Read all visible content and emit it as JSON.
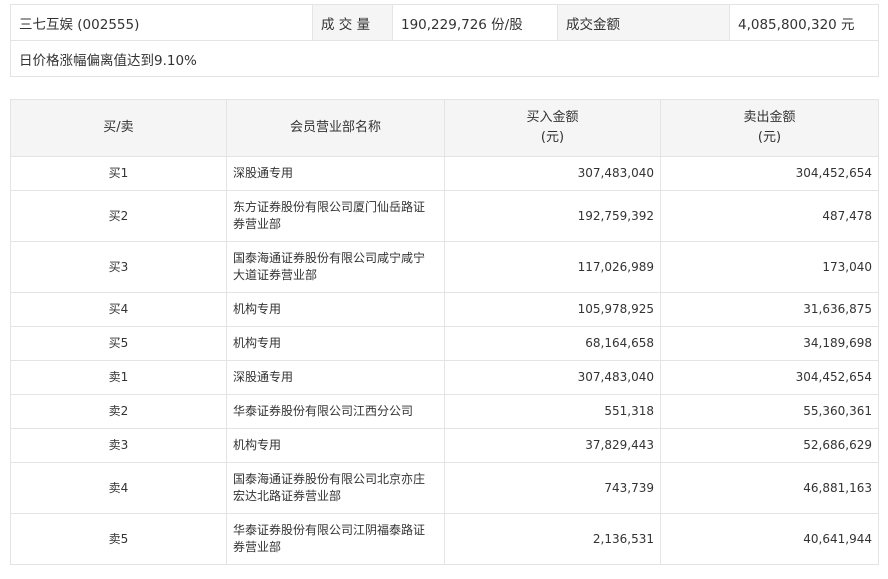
{
  "summary": {
    "stock": "三七互娱 (002555)",
    "volume_label": "成 交 量",
    "volume_value": "190,229,726 份/股",
    "amount_label": "成交金额",
    "amount_value": "4,085,800,320 元",
    "note": "日价格涨幅偏离值达到9.10%"
  },
  "table": {
    "headers": {
      "side": "买/卖",
      "dept": "会员营业部名称",
      "buy_line1": "买入金额",
      "buy_line2": "(元)",
      "sell_line1": "卖出金额",
      "sell_line2": "(元)"
    },
    "rows": [
      {
        "side": "买1",
        "dept": "深股通专用",
        "buy": "307,483,040",
        "sell": "304,452,654"
      },
      {
        "side": "买2",
        "dept": "东方证券股份有限公司厦门仙岳路证券营业部",
        "buy": "192,759,392",
        "sell": "487,478"
      },
      {
        "side": "买3",
        "dept": "国泰海通证券股份有限公司咸宁咸宁大道证券营业部",
        "buy": "117,026,989",
        "sell": "173,040"
      },
      {
        "side": "买4",
        "dept": "机构专用",
        "buy": "105,978,925",
        "sell": "31,636,875"
      },
      {
        "side": "买5",
        "dept": "机构专用",
        "buy": "68,164,658",
        "sell": "34,189,698"
      },
      {
        "side": "卖1",
        "dept": "深股通专用",
        "buy": "307,483,040",
        "sell": "304,452,654"
      },
      {
        "side": "卖2",
        "dept": "华泰证券股份有限公司江西分公司",
        "buy": "551,318",
        "sell": "55,360,361"
      },
      {
        "side": "卖3",
        "dept": "机构专用",
        "buy": "37,829,443",
        "sell": "52,686,629"
      },
      {
        "side": "卖4",
        "dept": "国泰海通证券股份有限公司北京亦庄宏达北路证券营业部",
        "buy": "743,739",
        "sell": "46,881,163"
      },
      {
        "side": "卖5",
        "dept": "华泰证券股份有限公司江阴福泰路证券营业部",
        "buy": "2,136,531",
        "sell": "40,641,944"
      }
    ]
  }
}
